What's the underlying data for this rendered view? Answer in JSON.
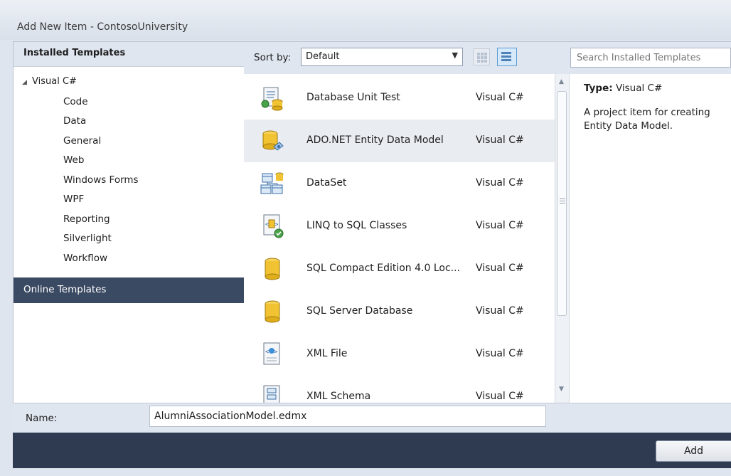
{
  "window": {
    "title": "Add New Item - ContosoUniversity"
  },
  "left_panel": {
    "installed_header": "Installed Templates",
    "tree_root": "Visual C#",
    "tree_items": [
      "Code",
      "Data",
      "General",
      "Web",
      "Windows Forms",
      "WPF",
      "Reporting",
      "Silverlight",
      "Workflow"
    ],
    "online_templates": "Online Templates"
  },
  "toolbar": {
    "sort_label": "Sort by:",
    "sort_value": "Default"
  },
  "search": {
    "placeholder": "Search Installed Templates"
  },
  "templates": [
    {
      "name": "Database Unit Test",
      "lang": "Visual C#",
      "icon": "database-unit-test-icon"
    },
    {
      "name": "ADO.NET Entity Data Model",
      "lang": "Visual C#",
      "icon": "entity-data-model-icon",
      "selected": true
    },
    {
      "name": "DataSet",
      "lang": "Visual C#",
      "icon": "dataset-icon"
    },
    {
      "name": "LINQ to SQL Classes",
      "lang": "Visual C#",
      "icon": "linq-to-sql-icon"
    },
    {
      "name": "SQL Compact Edition 4.0 Loc...",
      "lang": "Visual C#",
      "icon": "database-cylinder-icon"
    },
    {
      "name": "SQL Server Database",
      "lang": "Visual C#",
      "icon": "database-cylinder-icon"
    },
    {
      "name": "XML File",
      "lang": "Visual C#",
      "icon": "xml-file-icon"
    },
    {
      "name": "XML Schema",
      "lang": "Visual C#",
      "icon": "xml-schema-icon"
    }
  ],
  "details": {
    "type_label": "Type:",
    "type_value": "Visual C#",
    "description": "A project item for creating Entity Data Model."
  },
  "name_field": {
    "label": "Name:",
    "value": "AlumniAssociationModel.edmx"
  },
  "buttons": {
    "add": "Add"
  }
}
